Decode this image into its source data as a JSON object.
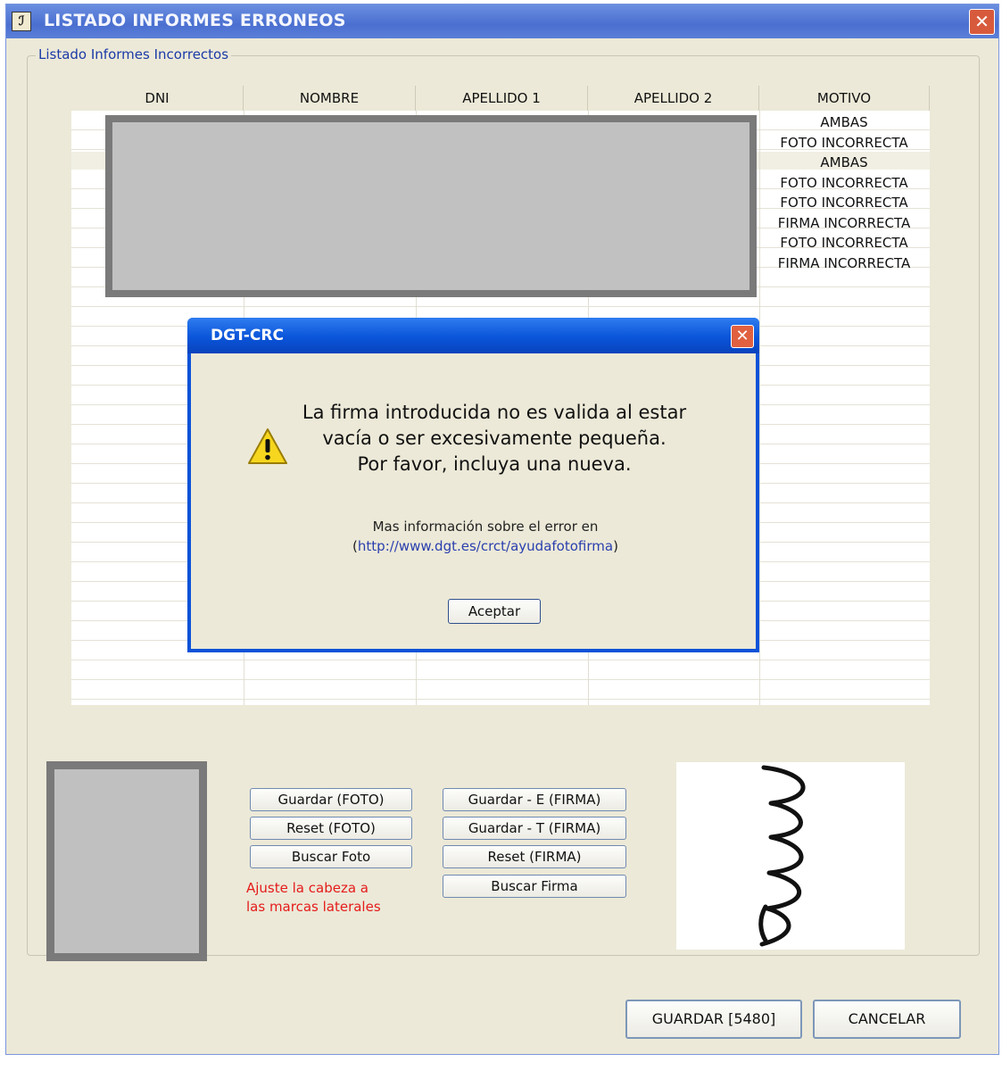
{
  "window": {
    "title": "LISTADO INFORMES ERRONEOS",
    "app_icon": "app-icon",
    "close_icon": "close-icon"
  },
  "group": {
    "label": "Listado Informes Incorrectos"
  },
  "table": {
    "columns": [
      "DNI",
      "NOMBRE",
      "APELLIDO 1",
      "APELLIDO 2",
      "MOTIVO"
    ],
    "motivos": [
      "AMBAS",
      "FOTO INCORRECTA",
      "AMBAS",
      "FOTO INCORRECTA",
      "FOTO INCORRECTA",
      "FIRMA INCORRECTA",
      "FOTO INCORRECTA",
      "FIRMA INCORRECTA"
    ]
  },
  "photo_buttons": [
    "Guardar (FOTO)",
    "Reset (FOTO)",
    "Buscar Foto"
  ],
  "signature_buttons": [
    "Guardar - E (FIRMA)",
    "Guardar - T (FIRMA)",
    "Reset (FIRMA)",
    "Buscar Firma"
  ],
  "hint": {
    "line1": "Ajuste la cabeza a",
    "line2": "las marcas laterales",
    "color": "#e51b1b"
  },
  "footer": {
    "save_label": "GUARDAR [5480]",
    "cancel_label": "CANCELAR"
  },
  "dialog": {
    "title": "DGT-CRC",
    "icon": "warning-icon",
    "message_lines": [
      "La firma introducida no es valida al estar",
      "vacía o ser excesivamente pequeña.",
      "Por favor, incluya una nueva."
    ],
    "more_info": "Mas información sobre el error en",
    "link_open": "(",
    "link": "http://www.dgt.es/crct/ayudafotofirma",
    "link_close": ")",
    "ok_label": "Aceptar"
  },
  "colors": {
    "titlebar": "#4a6fd0",
    "dialog_border": "#0b52d8",
    "window_bg": "#ece9d8",
    "link": "#2a3fae"
  }
}
